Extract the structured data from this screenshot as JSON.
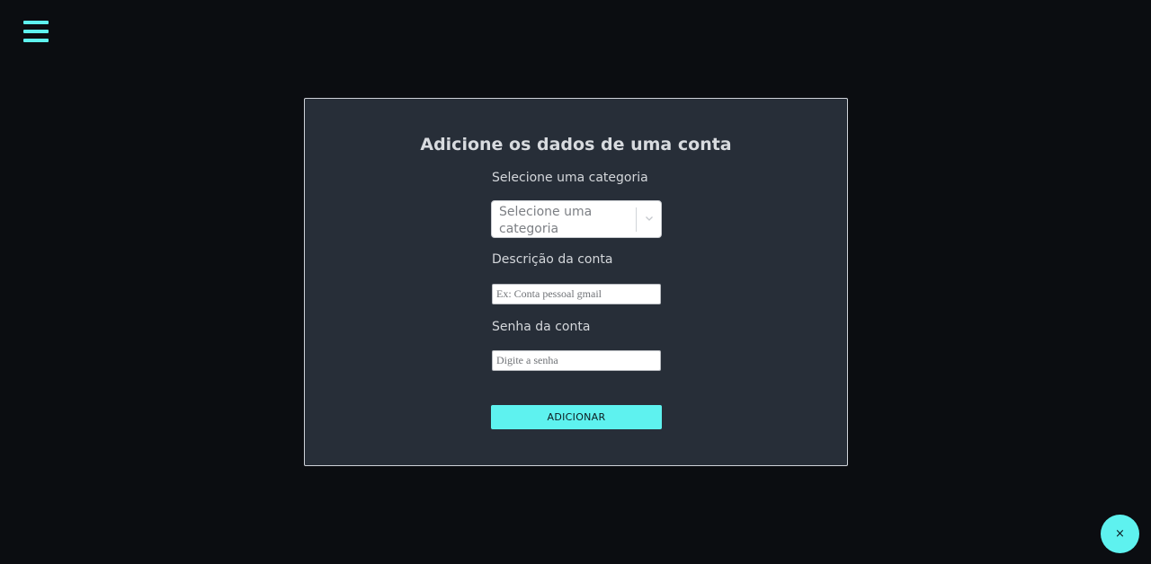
{
  "nav": {
    "menu_icon": "hamburger-menu-icon"
  },
  "form": {
    "title": "Adicione os dados de uma conta",
    "category": {
      "label": "Selecione uma categoria",
      "placeholder": "Selecione uma categoria",
      "icon": "chevron-down-icon"
    },
    "description": {
      "label": "Descrição da conta",
      "placeholder": "Ex: Conta pessoal gmail",
      "value": ""
    },
    "password": {
      "label": "Senha da conta",
      "placeholder": "Digite a senha",
      "value": ""
    },
    "submit_label": "ADICIONAR"
  },
  "fab": {
    "close_glyph": "×",
    "icon": "close-icon"
  },
  "colors": {
    "accent": "#5ef2ef",
    "background": "#0b0d11",
    "card": "#272e38"
  }
}
